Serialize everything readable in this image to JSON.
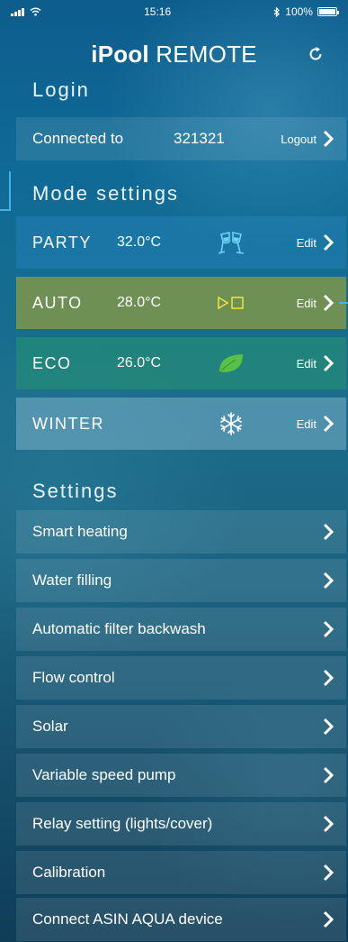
{
  "status": {
    "time": "15:16",
    "battery": "100%",
    "battery_level": 1.0
  },
  "header": {
    "title_bold": "iPool",
    "title_light": " REMOTE",
    "refresh_icon": "refresh-icon"
  },
  "login": {
    "heading": "Login",
    "connected_label": "Connected to",
    "connected_value": "321321",
    "logout_label": "Logout"
  },
  "modes": {
    "heading": "Mode settings",
    "items": [
      {
        "name": "PARTY",
        "temp": "32.0°C",
        "icon": "party-glasses-icon",
        "edit": "Edit"
      },
      {
        "name": "AUTO",
        "temp": "28.0°C",
        "icon": "play-stop-icon",
        "edit": "Edit"
      },
      {
        "name": "ECO",
        "temp": "26.0°C",
        "icon": "leaf-icon",
        "edit": "Edit"
      },
      {
        "name": "WINTER",
        "temp": "",
        "icon": "snowflake-icon",
        "edit": "Edit"
      }
    ]
  },
  "settings": {
    "heading": "Settings",
    "items": [
      {
        "label": "Smart heating"
      },
      {
        "label": "Water filling"
      },
      {
        "label": "Automatic filter backwash"
      },
      {
        "label": "Flow control"
      },
      {
        "label": "Solar"
      },
      {
        "label": "Variable speed pump"
      },
      {
        "label": "Relay setting (lights/cover)"
      },
      {
        "label": "Calibration"
      },
      {
        "label": "Connect ASIN AQUA device"
      }
    ]
  },
  "colors": {
    "accent": "#3fb6e6",
    "auto_icon": "#e8e23a",
    "leaf": "#59c04a"
  }
}
